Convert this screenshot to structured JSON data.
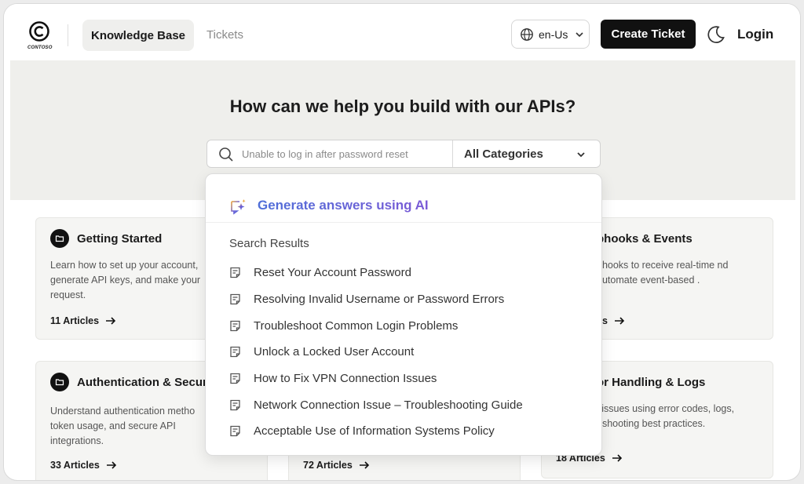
{
  "header": {
    "logo_text": "CONTOSO",
    "nav": {
      "knowledge_base": "Knowledge Base",
      "tickets": "Tickets"
    },
    "language": "en-Us",
    "create_ticket": "Create Ticket",
    "login": "Login"
  },
  "hero": {
    "title": "How can we help you build with our APIs?",
    "search_placeholder": "Unable to log in after password reset",
    "category": "All Categories"
  },
  "dropdown": {
    "ai_label": "Generate answers using AI",
    "results_heading": "Search Results",
    "results": [
      "Reset Your Account Password",
      "Resolving Invalid Username or Password Errors",
      "Troubleshoot Common Login Problems",
      "Unlock a Locked User Account",
      "How to Fix VPN Connection Issues",
      "Network Connection Issue – Troubleshooting Guide",
      "Acceptable Use of Information Systems Policy"
    ]
  },
  "cards": {
    "getting_started": {
      "title": "Getting Started",
      "desc": "Learn how to set up your account, generate API keys, and make your request.",
      "count": "11 Articles"
    },
    "webhooks": {
      "title": "phooks & Events",
      "desc": "bhooks to receive real-time nd automate event-based .",
      "count": "es"
    },
    "auth": {
      "title": "Authentication & Secur",
      "desc": "Understand authentication metho token usage, and secure API integrations.",
      "count": "33 Articles"
    },
    "middle": {
      "count": "72 Articles"
    },
    "errors": {
      "title": "or Handling & Logs",
      "desc": "l issues using error codes, logs, eshooting best practices.",
      "count": "18 Articles"
    }
  },
  "colors": {
    "accent": "#111111",
    "ai_gradient_start": "#4f6fd8",
    "ai_gradient_end": "#7b5ad6"
  }
}
